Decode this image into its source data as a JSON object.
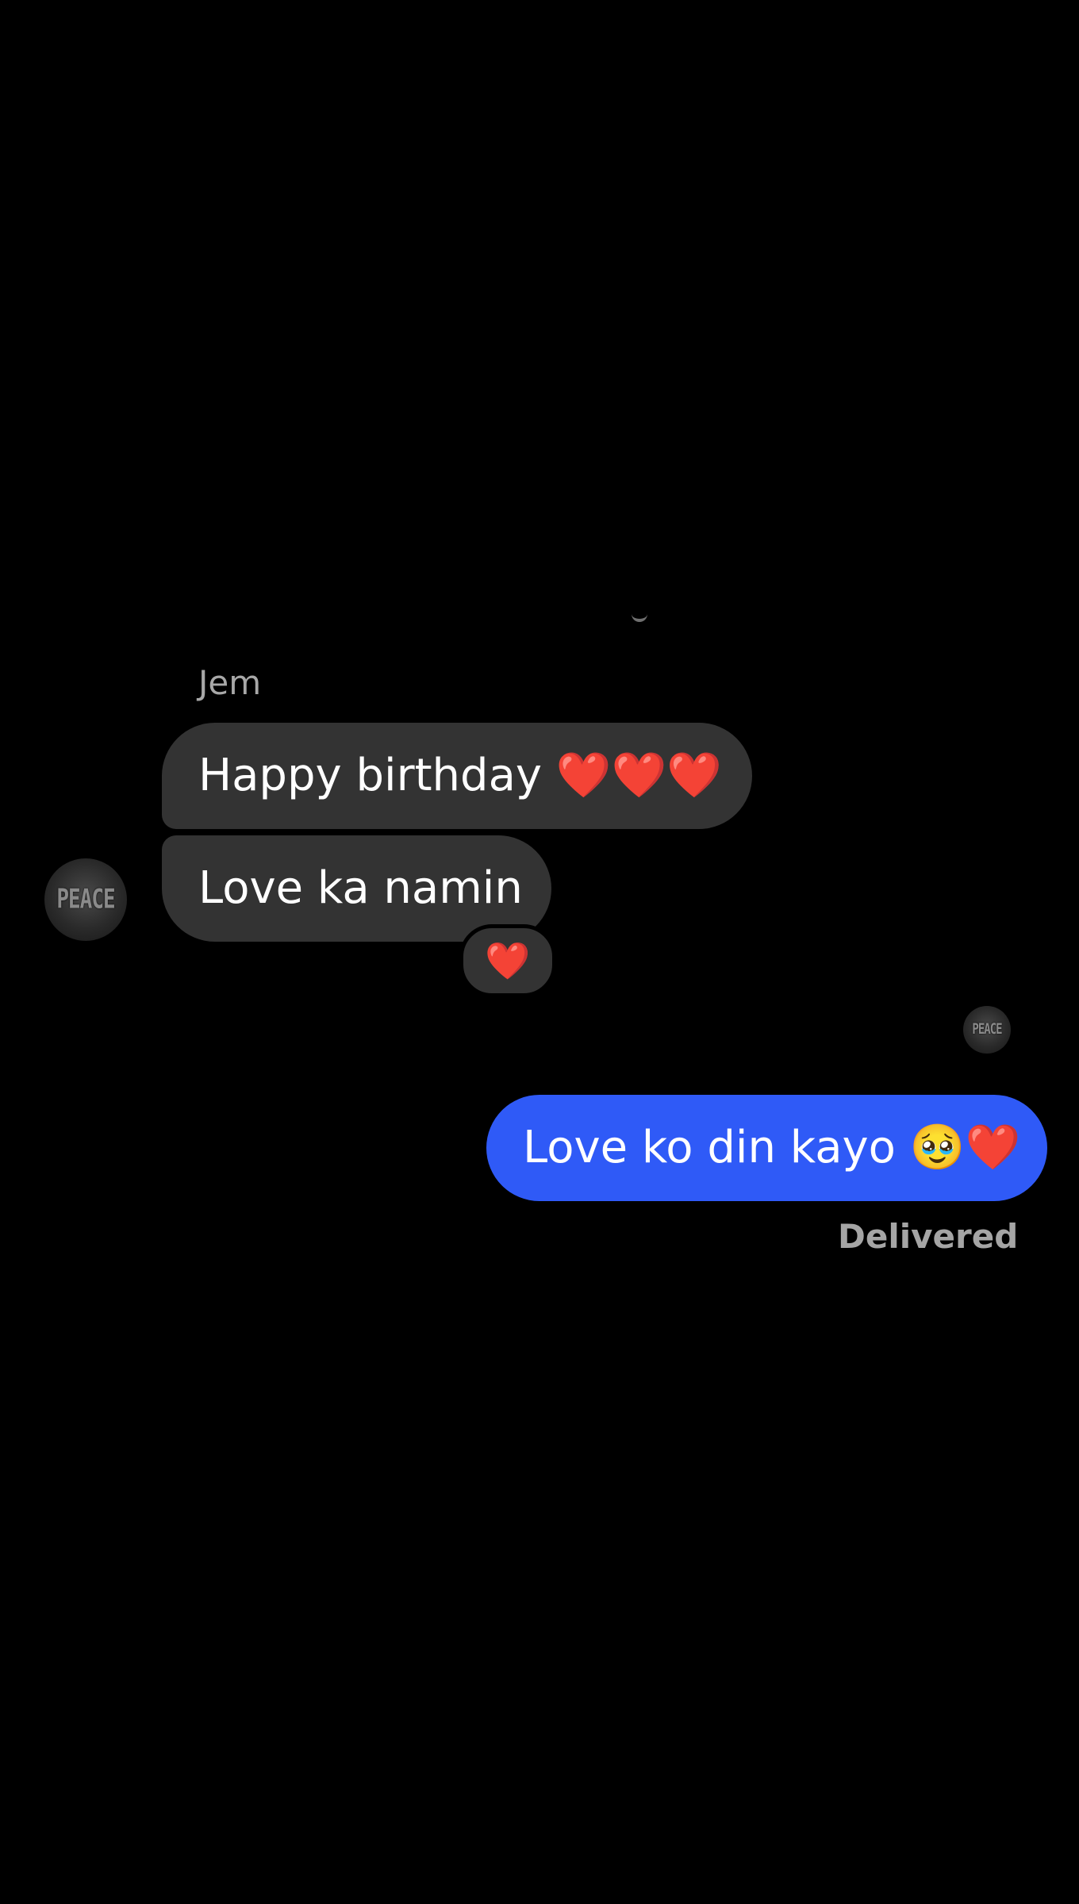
{
  "conversation": {
    "sender_name": "Jem",
    "incoming": [
      {
        "text": "Happy birthday ❤️❤️❤️"
      },
      {
        "text": "Love ka namin"
      }
    ],
    "reaction": "❤️",
    "outgoing": [
      {
        "text": "Love ko din kayo 🥹❤️",
        "status": "Delivered"
      }
    ],
    "avatar_text": "PEACE"
  },
  "colors": {
    "background": "#000000",
    "incoming_bubble": "#333333",
    "outgoing_bubble": "#2f5af7",
    "muted_text": "#a8a8a8"
  },
  "icons": {
    "contact_avatar": "peace-avatar-icon",
    "seen_avatar": "peace-avatar-icon"
  }
}
